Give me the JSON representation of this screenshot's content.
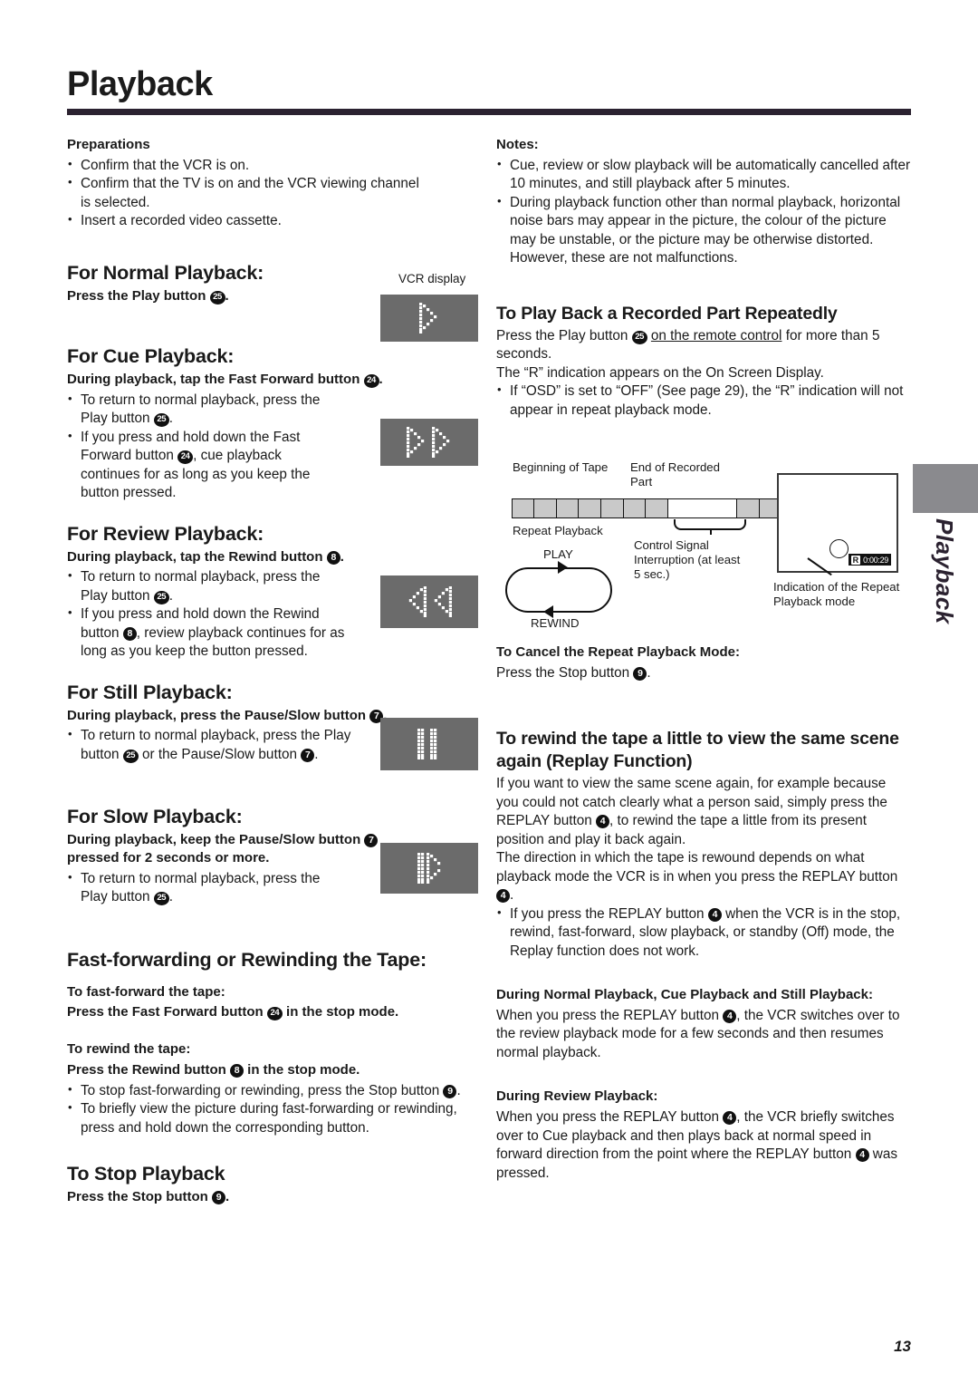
{
  "page": {
    "title": "Playback",
    "number": "13",
    "edge_tab_label": "Playback"
  },
  "left": {
    "preparations": {
      "heading": "Preparations",
      "items": [
        "Confirm that the VCR is on.",
        "Confirm that the TV is on and the VCR viewing channel is selected.",
        "Insert a recorded video cassette."
      ]
    },
    "normal": {
      "heading": "For Normal Playback:",
      "instruction_pre": "Press the Play button ",
      "instruction_badge": "25",
      "instruction_post": "."
    },
    "cue": {
      "heading": "For Cue Playback:",
      "instruction_pre": "During playback, tap the Fast Forward button ",
      "instruction_badge": "24",
      "instruction_post": ".",
      "bullet1_pre": "To return to normal playback, press the Play button ",
      "bullet1_badge": "25",
      "bullet1_post": ".",
      "bullet2_pre": "If you press and hold down the Fast Forward button ",
      "bullet2_badge": "24",
      "bullet2_post": ", cue playback continues for as long as you keep the button pressed."
    },
    "review": {
      "heading": "For Review Playback:",
      "instruction_pre": "During playback, tap the Rewind button ",
      "instruction_badge": "8",
      "instruction_post": ".",
      "bullet1_pre": "To return to normal playback, press the Play button ",
      "bullet1_badge": "25",
      "bullet1_post": ".",
      "bullet2_pre": "If you press and hold down the Rewind button ",
      "bullet2_badge": "8",
      "bullet2_post": ", review playback continues for as long as you keep the button pressed."
    },
    "still": {
      "heading": "For Still Playback:",
      "instruction_pre": "During playback, press the Pause/Slow button ",
      "instruction_badge": "7",
      "instruction_post": ".",
      "bullet1_pre": "To return to normal playback, press the Play button ",
      "bullet1_badge": "25",
      "bullet1_mid": " or the Pause/Slow button ",
      "bullet1_badge2": "7",
      "bullet1_post": "."
    },
    "slow": {
      "heading": "For Slow Playback:",
      "instruction_pre": "During playback, keep the Pause/Slow button ",
      "instruction_badge": "7",
      "instruction_post": " pressed for 2 seconds or more.",
      "bullet1_pre": "To return to normal playback, press the Play button ",
      "bullet1_badge": "25",
      "bullet1_post": "."
    },
    "ff_rew": {
      "heading": "Fast-forwarding or Rewinding the Tape:",
      "sub1": "To fast-forward the tape:",
      "sub1_line_pre": "Press the Fast Forward button ",
      "sub1_badge": "24",
      "sub1_line_post": " in the stop mode.",
      "sub2": "To rewind the tape:",
      "sub2_line_pre": "Press the Rewind button ",
      "sub2_badge": "8",
      "sub2_line_post": " in the stop mode.",
      "bullet1_pre": "To stop fast-forwarding or rewinding, press the Stop button ",
      "bullet1_badge": "9",
      "bullet1_post": ".",
      "bullet2": "To briefly view the picture during fast-forwarding or rewinding, press and hold down the corresponding button."
    },
    "stop": {
      "heading": "To Stop Playback",
      "instruction_pre": "Press the Stop button ",
      "instruction_badge": "9",
      "instruction_post": "."
    },
    "vcr_display_label": "VCR display"
  },
  "right": {
    "notes": {
      "heading": "Notes:",
      "items": [
        "Cue, review or slow playback will be automatically cancelled after 10 minutes, and still playback after 5 minutes.",
        "During playback function other than normal playback, horizontal noise bars may appear in the picture, the colour of the picture may be unstable, or the picture may be otherwise distorted. However, these are not malfunctions."
      ]
    },
    "repeat": {
      "heading": "To Play Back a Recorded Part Repeatedly",
      "line1_pre": "Press the Play button ",
      "line1_badge": "25",
      "line1_underlined": "on the remote control",
      "line1_post": " for more than 5 seconds.",
      "line2": "The “R” indication appears on the On Screen Display.",
      "bullet1": "If “OSD” is set to “OFF” (See page 29), the “R” indication will not appear in repeat playback mode."
    },
    "diagram": {
      "label_beginning": "Beginning of Tape",
      "label_end": "End of Recorded Part",
      "label_repeat": "Repeat Playback",
      "label_play": "PLAY",
      "label_rewind": "REWIND",
      "label_control": "Control Signal Interruption (at least 5 sec.)",
      "label_indication": "Indication of the Repeat Playback mode",
      "osd_r": "R",
      "osd_time": "0:00:29"
    },
    "cancel": {
      "heading": "To Cancel the Repeat Playback Mode:",
      "line_pre": "Press the Stop button ",
      "line_badge": "9",
      "line_post": "."
    },
    "replay": {
      "heading": "To rewind the tape a little to view the same scene again (Replay Function)",
      "para1_pre": "If you want to view the same scene again, for example because you could not catch clearly what a person said, simply press the REPLAY button ",
      "para1_badge": "4",
      "para1_post": ", to rewind the tape a little from its present position and play it back again.",
      "para2_pre": "The direction in which the tape is rewound depends on what playback mode the VCR is in when you press the REPLAY button ",
      "para2_badge": "4",
      "para2_post": ".",
      "bullet1_pre": "If you press the REPLAY button ",
      "bullet1_badge": "4",
      "bullet1_post": " when the VCR is in the stop, rewind, fast-forward, slow playback, or standby (Off) mode, the Replay function does not work.",
      "sub1": "During Normal Playback, Cue Playback and Still Playback:",
      "sub1_text_pre": "When you press the REPLAY button ",
      "sub1_badge": "4",
      "sub1_text_post": ", the VCR switches over to the review playback mode for a few seconds and then resumes normal playback.",
      "sub2": "During Review Playback:",
      "sub2_text_pre": "When you press the REPLAY button ",
      "sub2_badge": "4",
      "sub2_text_post": ", the VCR briefly switches over to Cue playback and then plays back at normal speed in forward direction from the point where the REPLAY button ",
      "sub2_badge2": "4",
      "sub2_text_end": " was pressed."
    }
  },
  "icons": {
    "play": "play-icon",
    "cue": "fast-forward-icon",
    "review": "rewind-icon",
    "still": "pause-icon",
    "slow": "slow-play-icon"
  }
}
